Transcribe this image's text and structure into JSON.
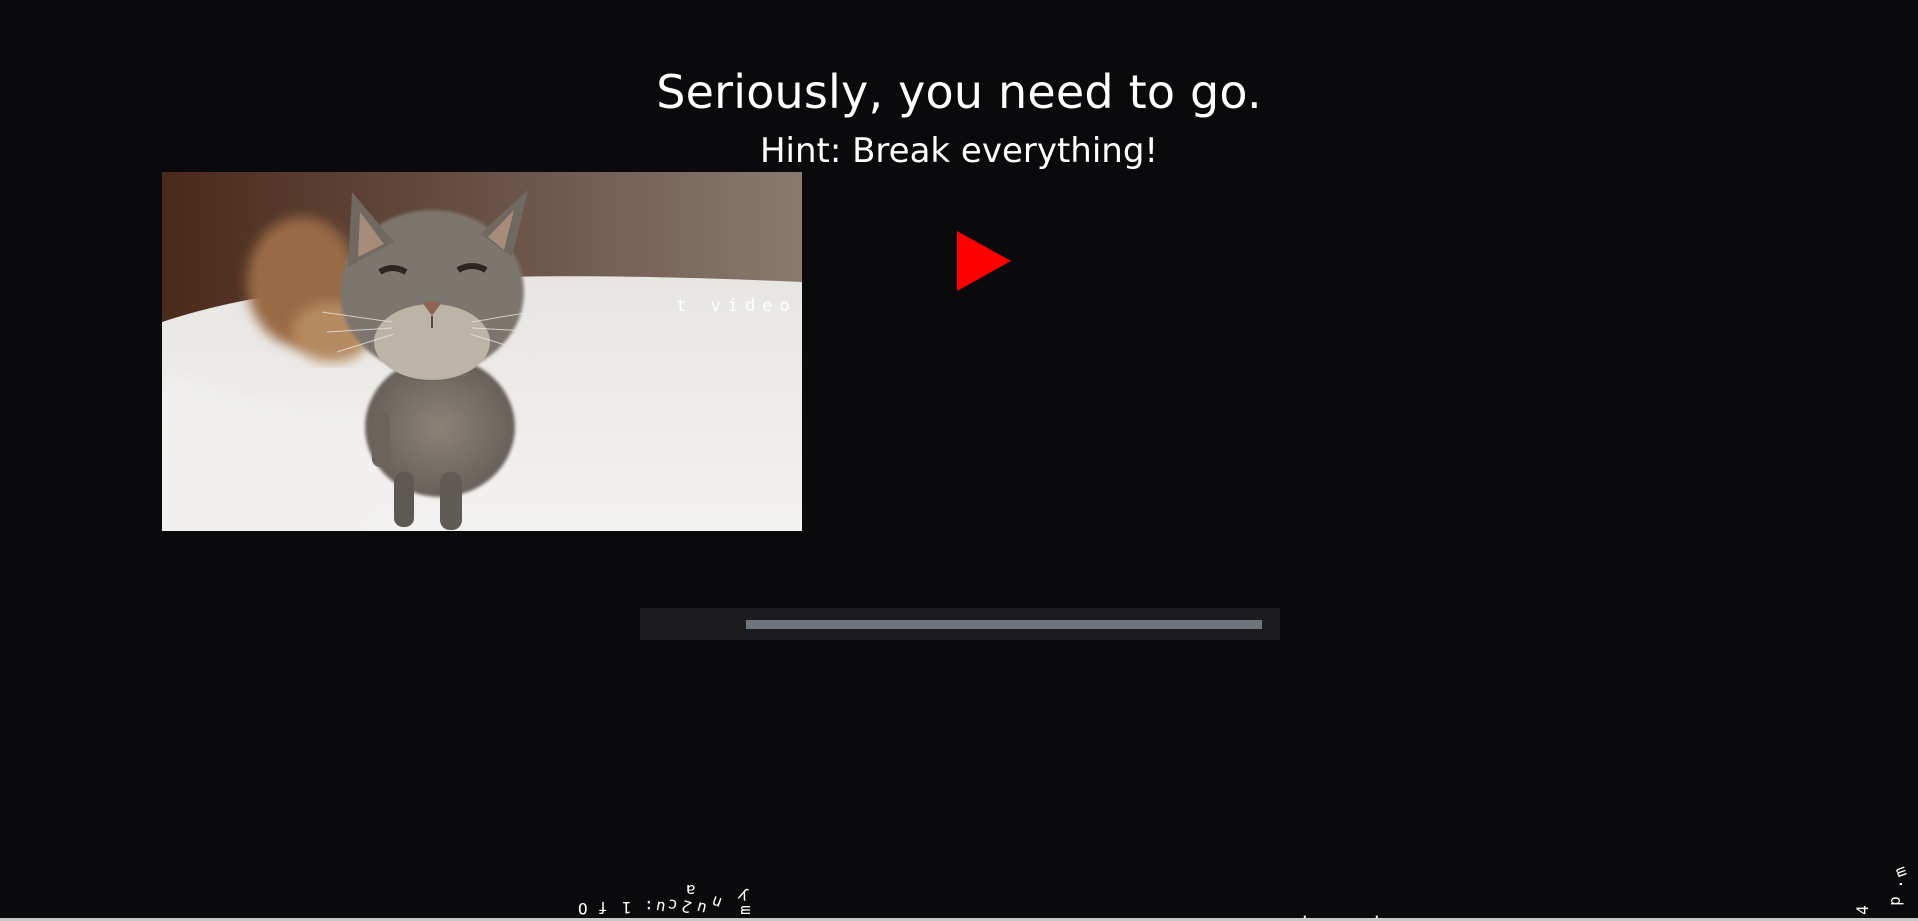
{
  "page": {
    "title": "Seriously, you need to go.",
    "hint": "Hint: Break everything!",
    "video_text": "t video"
  },
  "media": {
    "photo_alt": "Cat looking at camera",
    "play_icon": "play-icon",
    "accent_color": "#ff0000"
  },
  "progress": {
    "value": 1.0
  },
  "scattered_text": {
    "left_cluster": [
      "O",
      "f",
      "1",
      ":",
      "u",
      "c",
      "2",
      "u",
      "n",
      "a",
      "y",
      "m"
    ],
    "right_dots": [
      ".",
      "."
    ],
    "right_cluster": [
      "4",
      "p",
      ".",
      "m"
    ]
  }
}
